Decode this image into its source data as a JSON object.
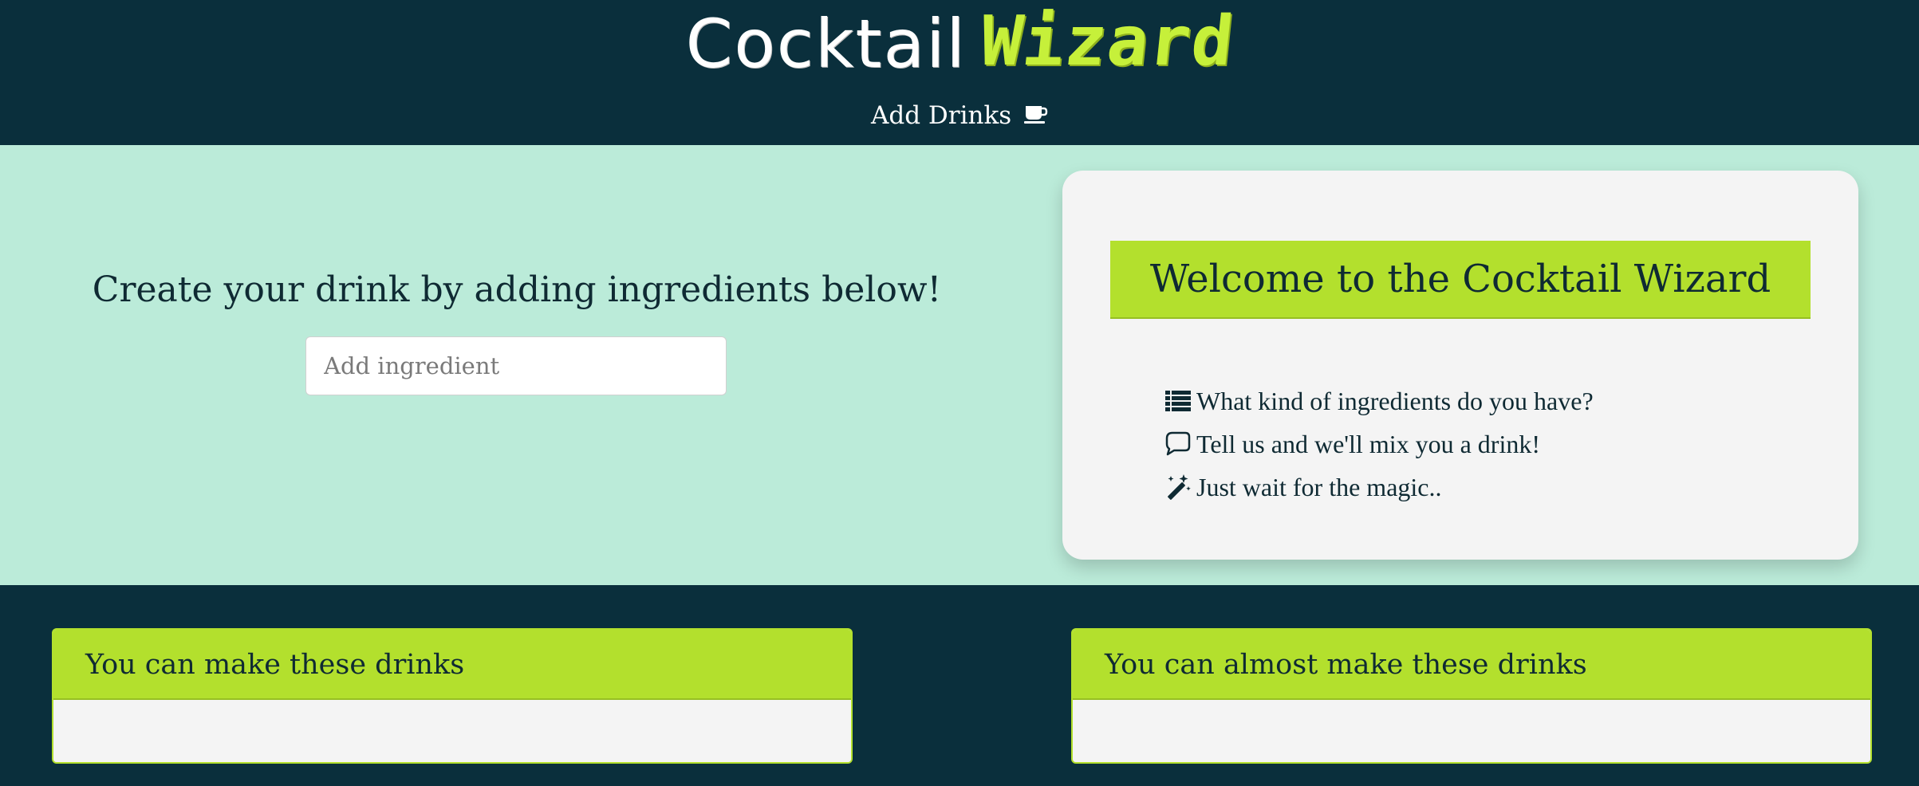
{
  "header": {
    "logo_part1": "Cocktail",
    "logo_part2": "Wizard",
    "nav_add_drinks": "Add Drinks",
    "nav_icon": "coffee-cup-icon"
  },
  "hero": {
    "title": "Create your drink by adding ingredients below!",
    "ingredient_placeholder": "Add ingredient"
  },
  "welcome": {
    "title": "Welcome to the Cocktail Wizard",
    "items": [
      {
        "icon": "list-icon",
        "text": "What kind of ingredients do you have?"
      },
      {
        "icon": "speech-bubble-icon",
        "text": "Tell us and we'll mix you a drink!"
      },
      {
        "icon": "magic-wand-icon",
        "text": "Just wait for the magic.."
      }
    ]
  },
  "panels": {
    "can_make_title": "You can make these drinks",
    "almost_make_title": "You can almost make these drinks"
  },
  "colors": {
    "navy": "#0a2f3c",
    "mint": "#bbebd9",
    "lime": "#b3e02d",
    "logo_lime": "#c6f03a",
    "card": "#f4f4f4"
  }
}
